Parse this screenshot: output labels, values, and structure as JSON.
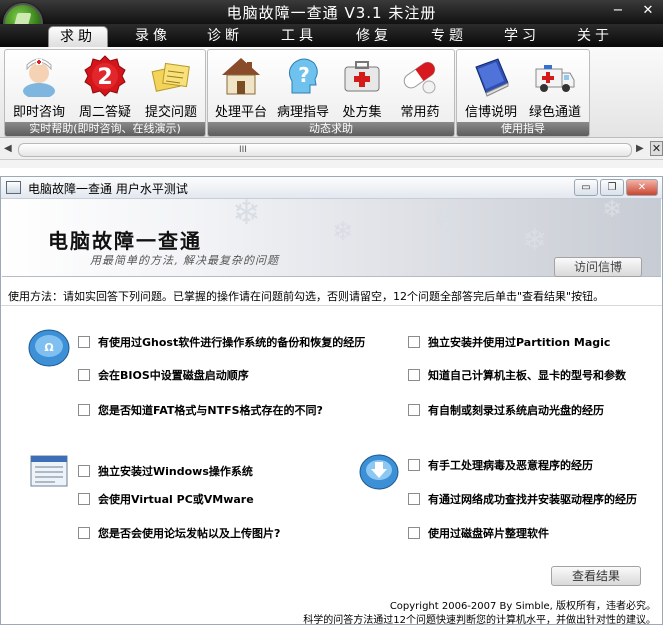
{
  "window": {
    "title": "电脑故障一查通  V3.1 未注册",
    "controls": {
      "minimize": "−",
      "close": "✕"
    }
  },
  "tabs": [
    {
      "label": "求助",
      "active": true
    },
    {
      "label": "录像"
    },
    {
      "label": "诊断"
    },
    {
      "label": "工具"
    },
    {
      "label": "修复"
    },
    {
      "label": "专题"
    },
    {
      "label": "学习"
    },
    {
      "label": "关于"
    }
  ],
  "ribbon": {
    "groups": [
      {
        "label": "实时帮助(即时咨询、在线演示)",
        "buttons": [
          {
            "label": "即时咨询",
            "icon": "nurse-icon"
          },
          {
            "label": "周二答疑",
            "icon": "red-number-2-icon",
            "badge": "2"
          },
          {
            "label": "提交问题",
            "icon": "notes-icon"
          }
        ]
      },
      {
        "label": "动态求助",
        "buttons": [
          {
            "label": "处理平台",
            "icon": "house-icon"
          },
          {
            "label": "病理指导",
            "icon": "question-head-icon",
            "badge": "?"
          },
          {
            "label": "处方集",
            "icon": "first-aid-kit-icon"
          },
          {
            "label": "常用药",
            "icon": "pills-icon"
          }
        ]
      },
      {
        "label": "使用指导",
        "buttons": [
          {
            "label": "信博说明",
            "icon": "book-icon"
          },
          {
            "label": "绿色通道",
            "icon": "ambulance-icon"
          }
        ]
      }
    ]
  },
  "scrollbar": {
    "left_arrow": "◀",
    "grip": "III",
    "right_arrow": "▶",
    "close": "✕"
  },
  "doc": {
    "title": "电脑故障一查通  用户水平测试",
    "buttons": {
      "minimize": "▭",
      "restore": "❐",
      "close": "✕"
    },
    "banner_title": "电脑故障一查通",
    "banner_subtitle": "用最简单的方法, 解决最复杂的问题",
    "visit_button": "访问信博",
    "instructions": "使用方法：请如实回答下列问题。已掌握的操作请在问题前勾选，否则请留空，12个问题全部答完后单击\"查看结果\"按钮。",
    "questions_left": [
      "有使用过Ghost软件进行操作系统的备份和恢复的经历",
      "会在BIOS中设置磁盘启动顺序",
      "您是否知道FAT格式与NTFS格式存在的不同?",
      "独立安装过Windows操作系统",
      "会使用Virtual PC或VMware",
      "您是否会使用论坛发帖以及上传图片?"
    ],
    "questions_right": [
      "独立安装并使用过Partition Magic",
      "知道自己计算机主板、显卡的型号和参数",
      "有自制或刻录过系统启动光盘的经历",
      "有手工处理病毒及恶意程序的经历",
      "有通过网络成功查找并安装驱动程序的经历",
      "使用过磁盘碎片整理软件"
    ],
    "result_button": "查看结果",
    "copyright": "Copyright 2006-2007 By Simble, 版权所有，违者必究。",
    "footer": "科学的问答方法通过12个问题快速判断您的计算机水平，并做出针对性的建议。"
  }
}
